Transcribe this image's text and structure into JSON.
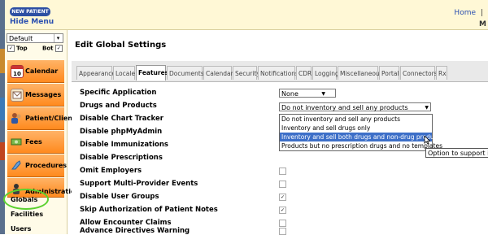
{
  "header": {
    "new_patient_label": "NEW PATIENT",
    "hide_menu_label": "Hide Menu",
    "home_label": "Home",
    "home_sep": "|",
    "right_mark": "M"
  },
  "leftnav": {
    "layout_value": "Default",
    "top_label": "Top",
    "bot_label": "Bot",
    "top_checked": "✓",
    "bot_checked": "✓",
    "menu": [
      {
        "label": "Calendar",
        "icon": "calendar-icon"
      },
      {
        "label": "Messages",
        "icon": "messages-icon"
      },
      {
        "label": "Patient/Client",
        "icon": "patient-icon"
      },
      {
        "label": "Fees",
        "icon": "fees-icon"
      },
      {
        "label": "Procedures",
        "icon": "procedures-icon"
      },
      {
        "label": "Administration",
        "icon": "administration-icon"
      }
    ],
    "sub_items": [
      "Globals",
      "Facilities",
      "Users"
    ]
  },
  "main": {
    "title": "Edit Global Settings",
    "tabs": [
      "Appearance",
      "Locale",
      "Features",
      "Documents",
      "Calendar",
      "Security",
      "Notifications",
      "CDR",
      "Logging",
      "Miscellaneous",
      "Portal",
      "Connectors",
      "Rx"
    ],
    "active_tab": "Features",
    "rows": [
      {
        "label": "Specific Application",
        "control": "select",
        "value": "None"
      },
      {
        "label": "Drugs and Products",
        "control": "select",
        "value": "Do not inventory and sell any products"
      },
      {
        "label": "Disable Chart Tracker",
        "control": "checkbox",
        "checked": ""
      },
      {
        "label": "Disable phpMyAdmin",
        "control": "checkbox",
        "checked": ""
      },
      {
        "label": "Disable Immunizations",
        "control": "checkbox",
        "checked": ""
      },
      {
        "label": "Disable Prescriptions",
        "control": "checkbox",
        "checked": ""
      },
      {
        "label": "Omit Employers",
        "control": "checkbox",
        "checked": ""
      },
      {
        "label": "Support Multi-Provider Events",
        "control": "checkbox",
        "checked": ""
      },
      {
        "label": "Disable User Groups",
        "control": "checkbox",
        "checked": "✓"
      },
      {
        "label": "Skip Authorization of Patient Notes",
        "control": "checkbox",
        "checked": "✓"
      },
      {
        "label": "Allow Encounter Claims",
        "control": "checkbox",
        "checked": ""
      },
      {
        "label": "Advance Directives Warning",
        "control": "checkbox",
        "checked": ""
      }
    ],
    "dropdown_options": [
      "Do not inventory and sell any products",
      "Inventory and sell drugs only",
      "Inventory and sell both drugs and non-drug products",
      "Products but no prescription drugs and no templates"
    ],
    "highlighted_option": 2,
    "tooltip": "Option to support inventory"
  },
  "colors": {
    "header_bg": "#fff8d6",
    "menu_orange": "#ff8a1e",
    "link_blue": "#2a4fb0",
    "highlight_blue": "#3d6fc8",
    "globals_ring": "#5bd12f"
  }
}
